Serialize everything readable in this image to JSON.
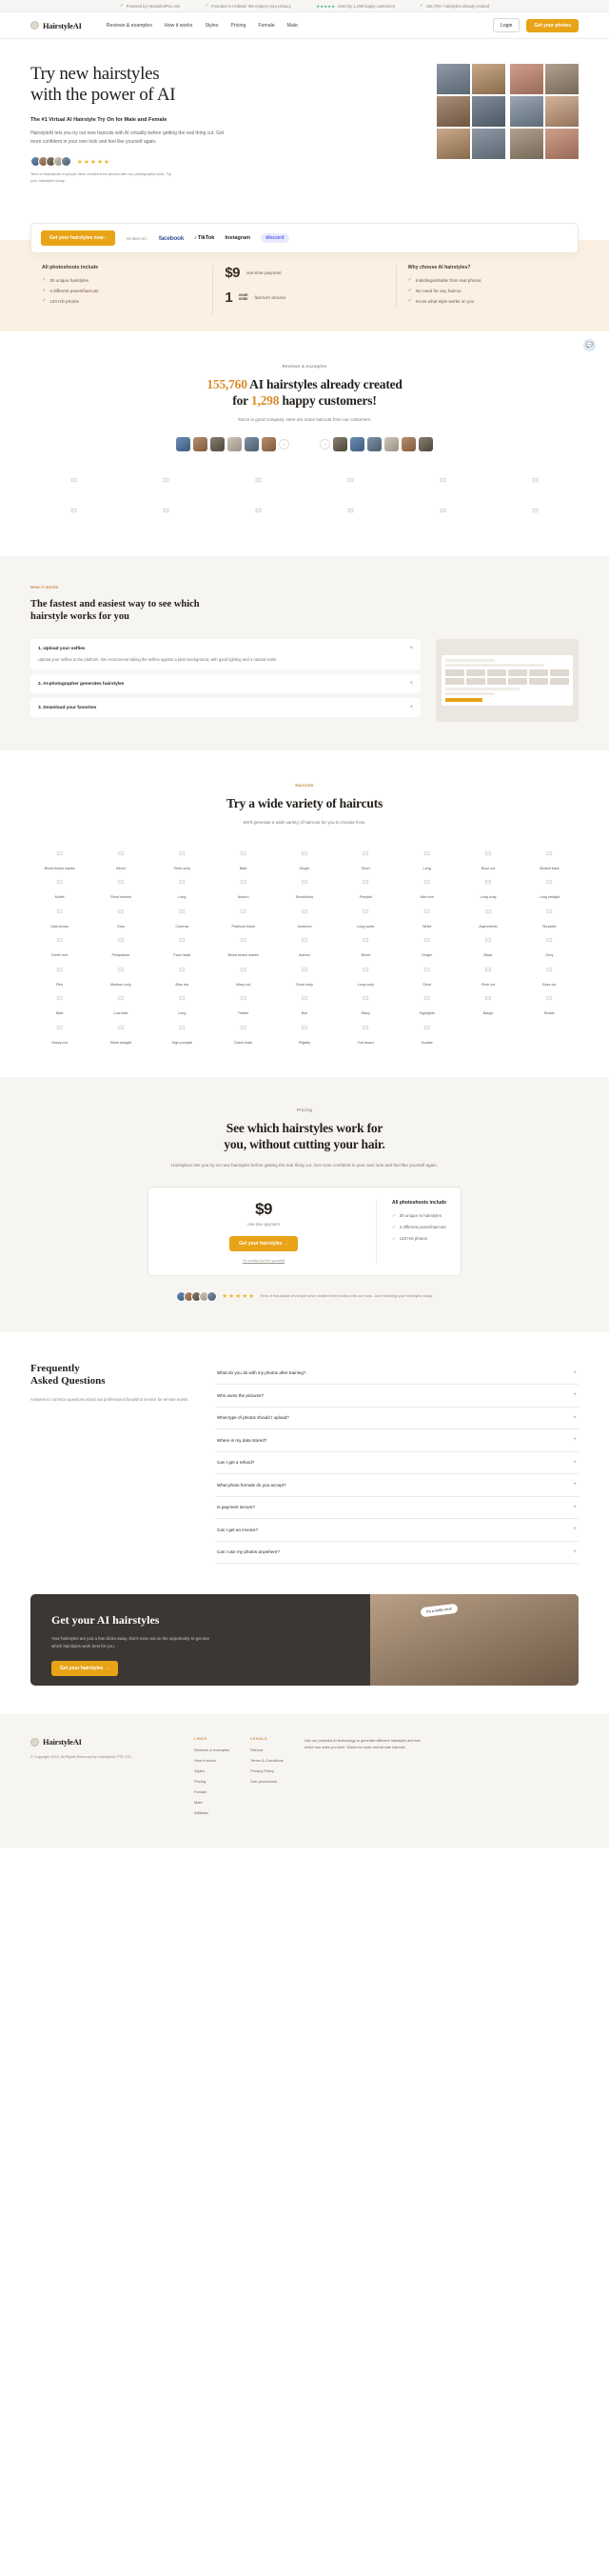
{
  "announce": {
    "items": [
      {
        "icon": "check-icon",
        "text": "Powered by HeadshotPro.com"
      },
      {
        "icon": "check-icon",
        "text": "Founded in Holland. We respect your privacy."
      },
      {
        "icon": "stars-icon",
        "text": "Used by 1,298 happy customers"
      },
      {
        "icon": "check-icon",
        "text": "155,760+ hairstyles already created"
      }
    ]
  },
  "header": {
    "brand": "HairstyleAI",
    "links": [
      "Reviews & examples",
      "How it works",
      "Styles",
      "Pricing",
      "Female",
      "Male"
    ],
    "login_label": "Login",
    "cta_label": "Get your photos"
  },
  "hero": {
    "title_line1": "Try new hairstyles",
    "title_line2": "with the power of AI",
    "subtitle": "The #1 Virtual AI Hairstyle Try On for Male and Female",
    "body": "HairstyleAI lets you try out new haircuts with AI virtually before getting the real thing cut. Get more confident in your own look and feel like yourself again.",
    "stars": "★★★★★",
    "proof_note": "Tens of thousands of people have created their photos with our photography tools. Try your hairstyles today."
  },
  "cta_bar": {
    "button": "Get your hairstyles now",
    "arrow": "›",
    "seen_on": "As seen on:",
    "logos": [
      "facebook",
      "TikTok",
      "Instagram",
      "discord"
    ]
  },
  "band": {
    "col1": {
      "title": "All photoshoots include",
      "items": [
        "30 unique hairstyles",
        "4 different poses/haircuts",
        "120 HD photos"
      ]
    },
    "col2": {
      "price": "$9",
      "price_note": "one-time payment",
      "hours": "1",
      "hours_badge_line1": "HOUR",
      "hours_badge_line2": "DONE",
      "hours_note": "fast turn around"
    },
    "col3": {
      "title": "Why choose AI hairstyles?",
      "items": [
        "Indistinguishable from real photos",
        "No need for any haircut",
        "Know what style works on you"
      ]
    }
  },
  "reviews": {
    "eyebrow": "Reviews & examples",
    "headline_count": "155,760",
    "headline_part1": " AI hairstyles already created",
    "headline_part2": "for ",
    "headline_count2": "1,298",
    "headline_part3": " happy customers!",
    "subtitle": "You're in good company. Here are some haircuts from our customers.",
    "prev": "‹",
    "next": "›",
    "tile_icon": "image-placeholder-icon"
  },
  "how_it_works": {
    "eyebrow": "How it works",
    "headline": "The fastest and easiest way to see which hairstyle works for you",
    "steps": [
      {
        "title": "1. Upload your selfies",
        "toggle": "×",
        "body": "Upload your selfies to the platform. We recommend taking the selfies against a plain background, with good lighting and a natural smile."
      },
      {
        "title": "2. AI-photographer generates hairstyles",
        "toggle": "+",
        "body": ""
      },
      {
        "title": "3. Download your favorites",
        "toggle": "+",
        "body": ""
      }
    ],
    "screenshot_label": "HairstyleAI upload interface"
  },
  "haircuts": {
    "eyebrow": "Haircuts",
    "headline": "Try a wide variety of haircuts",
    "subtitle": "We'll generate a wide variety of haircuts for you to choose from.",
    "items": [
      "Blond beach waves",
      "Blond",
      "Short curly",
      "Bald",
      "Ginger",
      "Short",
      "Long",
      "Buzz cut",
      "Slicked back",
      "Mullet",
      "Short shaved",
      "Long",
      "Auburn",
      "Dreadlocks",
      "Ponytail",
      "Man bun",
      "Long curly",
      "Long straight",
      "Dark brows",
      "Grey",
      "Cornrow",
      "Platinum blond",
      "Undercut",
      "Long surfer",
      "White",
      "Asymmetric",
      "Shoulder",
      "Comb over",
      "Pompadour",
      "Faux hawk",
      "Blond beach waves",
      "Auburn",
      "Blond",
      "Ginger",
      "Black",
      "Grey",
      "Pink",
      "Medium curly",
      "Blue red",
      "Wavy cut",
      "Short curly",
      "Long curly",
      "Short",
      "Pixie cut",
      "Buzz cut",
      "Bald",
      "Low fade",
      "Long",
      "Parted",
      "Bob",
      "Wavy",
      "Highlights",
      "Bangs",
      "Braids",
      "Heavy box",
      "Sleek straight",
      "High ponytail",
      "Dutch braid",
      "Pigtails",
      "Full beard",
      "Goatee"
    ]
  },
  "pricing": {
    "eyebrow": "Pricing",
    "headline_line1": "See which hairstyles work for",
    "headline_line2": "you, without cutting your hair.",
    "subtitle": "HairstyleAI lets you try on new hairstyles before getting the real thing cut. Get more confident in your own look and feel like yourself again.",
    "price": "$9",
    "price_note": "one-time payment",
    "cta": "Get your hairstyles",
    "cta_arrow": "→",
    "secondary_link": "Or create tool for yourself",
    "includes_title": "All photoshoots include",
    "includes": [
      "30 unique AI hairstyles",
      "4 different poses/haircuts",
      "120 HD photos"
    ],
    "stars": "★★★★★",
    "proof_note": "Tens of thousands of people have created their photos with our tools. Just matching your hairstyles today."
  },
  "faq": {
    "title_line1": "Frequently",
    "title_line2": "Asked Questions",
    "subtitle": "Answers to common questions about our professional headshot service for remote teams.",
    "questions": [
      "What do you do with my photos after training?",
      "Who owns the pictures?",
      "What type of photos should I upload?",
      "Where is my data stored?",
      "Can I get a refund?",
      "What photo formats do you accept?",
      "Is payment secure?",
      "Can I get an invoice?",
      "Can I use my photos anywhere?"
    ],
    "plus": "+"
  },
  "final_cta": {
    "title": "Get your AI hairstyles",
    "body": "Your hairstyles are just a few clicks away. Don't miss out on the opportunity to get see which hairstyles work best for you.",
    "button": "Get your hairstyles",
    "button_arrow": "→",
    "bubble": "It's a really nice!"
  },
  "footer": {
    "brand": "HairstyleAI",
    "copyright": "© Copyright 2024. All Rights Reserved by HairstyleAI PTE LTD.",
    "links_title": "LINKS",
    "links": [
      "Reviews & examples",
      "How it works",
      "Styles",
      "Pricing",
      "Female",
      "Male",
      "Affiliates"
    ],
    "legal_title": "LEGALS",
    "legal": [
      "Refund",
      "Terms & Conditions",
      "Privacy Policy",
      "Sub-processors"
    ],
    "about": "Use our powerful AI technology to generate different hairstyles and see which one suits you best. Works for male and female haircuts."
  },
  "chat": {
    "icon": "chat-icon"
  }
}
